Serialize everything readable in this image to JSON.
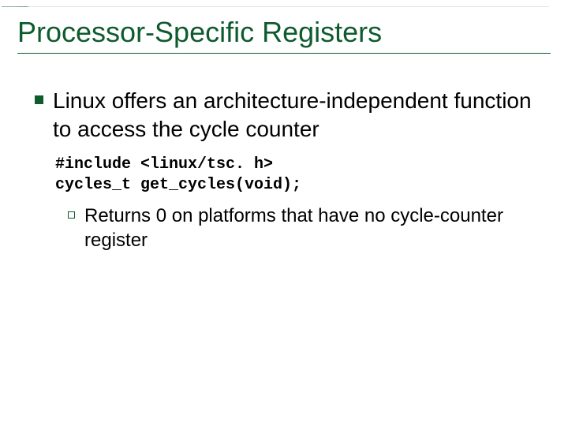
{
  "title": "Processor-Specific Registers",
  "point1": "Linux offers an architecture-independent function to access the cycle counter",
  "code": {
    "line1": "#include <linux/tsc. h>",
    "line2": "cycles_t get_cycles(void);"
  },
  "sub1": "Returns 0 on platforms that have no cycle-counter register"
}
